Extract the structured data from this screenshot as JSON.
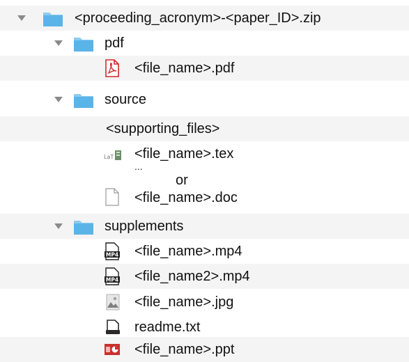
{
  "tree": {
    "root": {
      "label": "<proceeding_acronym>-<paper_ID>.zip",
      "icon": "folder-icon",
      "expanded": true
    },
    "pdf_folder": {
      "label": "pdf",
      "icon": "folder-icon",
      "expanded": true
    },
    "pdf_file": {
      "label": "<file_name>.pdf",
      "icon": "pdf-file-icon"
    },
    "source_folder": {
      "label": "source",
      "icon": "folder-icon",
      "expanded": true
    },
    "supporting": {
      "label": "<supporting_files>"
    },
    "tex_file": {
      "label": "<file_name>.tex",
      "icon": "tex-file-icon"
    },
    "ellipsis": "...",
    "or_text": "or",
    "doc_file": {
      "label": "<file_name>.doc",
      "icon": "document-icon"
    },
    "supplements_folder": {
      "label": "supplements",
      "icon": "folder-icon",
      "expanded": true
    },
    "mp4_file": {
      "label": "<file_name>.mp4",
      "icon": "mp4-file-icon"
    },
    "mp4_file2": {
      "label": "<file_name2>.mp4",
      "icon": "mp4-file-icon"
    },
    "jpg_file": {
      "label": "<file_name>.jpg",
      "icon": "image-file-icon"
    },
    "readme_file": {
      "label": "readme.txt",
      "icon": "text-file-icon"
    },
    "ppt_file": {
      "label": "<file_name>.ppt",
      "icon": "ppt-file-icon"
    }
  },
  "colors": {
    "folder": "#5ab4e8",
    "folder_tab": "#8dcbf0",
    "disclosure": "#8a8a8a",
    "row_alt": "#f4f4f4",
    "pdf_red": "#d0262b",
    "ppt_red": "#c9302c"
  }
}
